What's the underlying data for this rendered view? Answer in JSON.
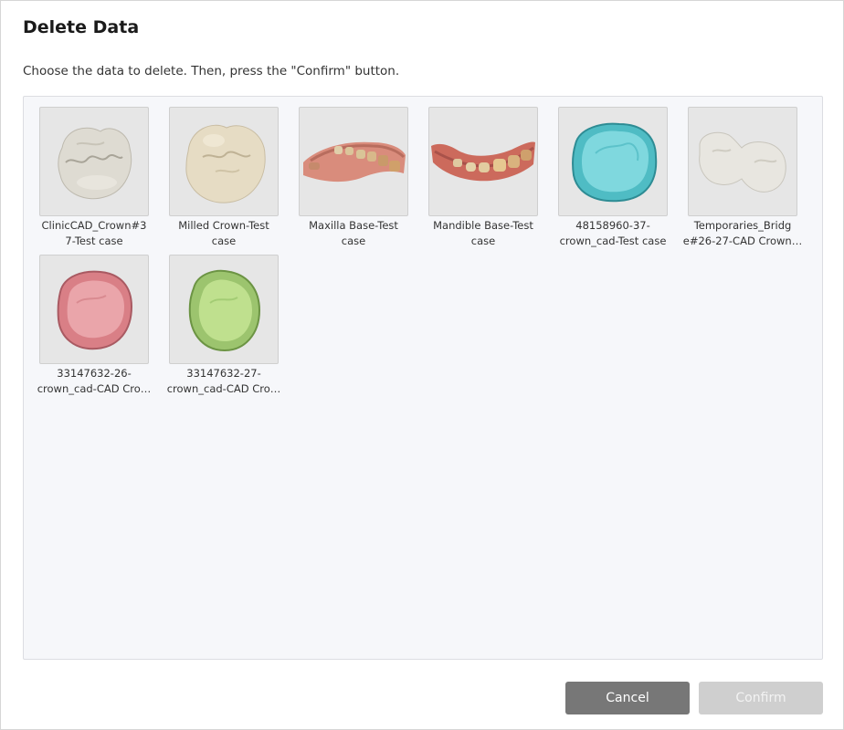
{
  "dialog": {
    "title": "Delete Data",
    "instruction": "Choose the data to delete. Then, press the \"Confirm\" button."
  },
  "items": [
    {
      "label": "ClinicCAD_Crown#3\n7-Test case",
      "thumb": "crown-white-icon"
    },
    {
      "label": "Milled Crown-Test\ncase",
      "thumb": "crown-ivory-icon"
    },
    {
      "label": "Maxilla Base-Test\ncase",
      "thumb": "maxilla-scan-icon"
    },
    {
      "label": "Mandible Base-Test\ncase",
      "thumb": "mandible-scan-icon"
    },
    {
      "label": "48158960-37-\ncrown_cad-Test case",
      "thumb": "crown-cyan-icon"
    },
    {
      "label": "Temporaries_Bridg\ne#26-27-CAD Crown…",
      "thumb": "bridge-white-icon"
    },
    {
      "label": "33147632-26-\ncrown_cad-CAD Cro…",
      "thumb": "crown-pink-icon"
    },
    {
      "label": "33147632-27-\ncrown_cad-CAD Cro…",
      "thumb": "crown-green-icon"
    }
  ],
  "buttons": {
    "cancel": "Cancel",
    "confirm": "Confirm"
  },
  "colors": {
    "cancel_bg": "#777777",
    "confirm_disabled_bg": "#cfcfcf",
    "panel_bg": "#f6f7fa"
  }
}
